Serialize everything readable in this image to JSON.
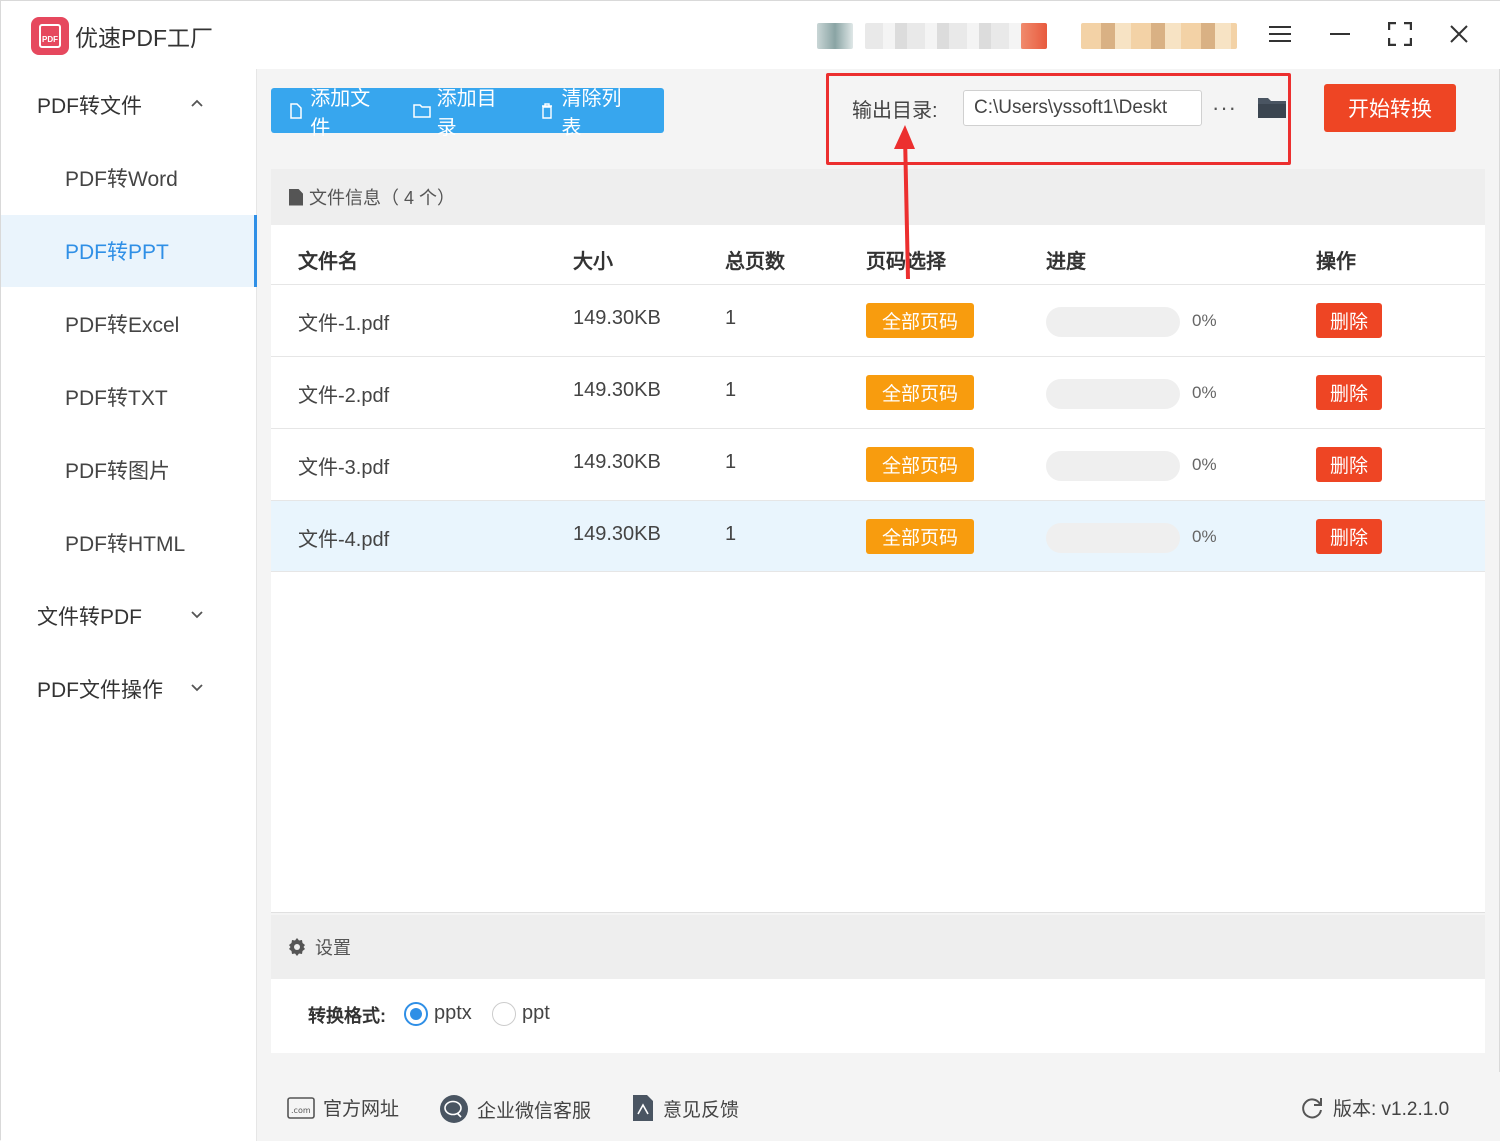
{
  "app": {
    "title": "优速PDF工厂",
    "logo_text": "PDF"
  },
  "window_controls": [
    "menu-icon",
    "minimize-icon",
    "maximize-icon",
    "close-icon"
  ],
  "sidebar": {
    "groups": [
      {
        "label": "PDF转文件",
        "expanded": true
      },
      {
        "label": "文件转PDF",
        "expanded": false
      },
      {
        "label": "PDF文件操作",
        "expanded": false
      }
    ],
    "items": [
      {
        "label": "PDF转Word",
        "active": false
      },
      {
        "label": "PDF转PPT",
        "active": true
      },
      {
        "label": "PDF转Excel",
        "active": false
      },
      {
        "label": "PDF转TXT",
        "active": false
      },
      {
        "label": "PDF转图片",
        "active": false
      },
      {
        "label": "PDF转HTML",
        "active": false
      }
    ]
  },
  "toolbar": {
    "add_file": "添加文件",
    "add_folder": "添加目录",
    "clear_list": "清除列表",
    "output_label": "输出目录:",
    "output_path": "C:\\Users\\yssoft1\\Deskt",
    "more": "···",
    "start": "开始转换"
  },
  "file_panel": {
    "header": "文件信息（ 4 个）",
    "columns": [
      "文件名",
      "大小",
      "总页数",
      "页码选择",
      "进度",
      "操作"
    ],
    "rows": [
      {
        "name": "文件-1.pdf",
        "size": "149.30KB",
        "pages": "1",
        "page_select": "全部页码",
        "progress": 0,
        "progress_text": "0%",
        "action": "删除",
        "highlighted": false
      },
      {
        "name": "文件-2.pdf",
        "size": "149.30KB",
        "pages": "1",
        "page_select": "全部页码",
        "progress": 0,
        "progress_text": "0%",
        "action": "删除",
        "highlighted": false
      },
      {
        "name": "文件-3.pdf",
        "size": "149.30KB",
        "pages": "1",
        "page_select": "全部页码",
        "progress": 0,
        "progress_text": "0%",
        "action": "删除",
        "highlighted": false
      },
      {
        "name": "文件-4.pdf",
        "size": "149.30KB",
        "pages": "1",
        "page_select": "全部页码",
        "progress": 0,
        "progress_text": "0%",
        "action": "删除",
        "highlighted": true
      }
    ]
  },
  "settings": {
    "header": "设置",
    "format_label": "转换格式:",
    "options": [
      {
        "label": "pptx",
        "selected": true
      },
      {
        "label": "ppt",
        "selected": false
      }
    ]
  },
  "footer": {
    "website": "官方网址",
    "wechat": "企业微信客服",
    "feedback": "意见反馈",
    "version": "版本:  v1.2.1.0"
  },
  "colors": {
    "accent_blue": "#37a6ee",
    "orange": "#f89c0e",
    "red": "#ee4524",
    "annotation_red": "#ec2f2f"
  }
}
